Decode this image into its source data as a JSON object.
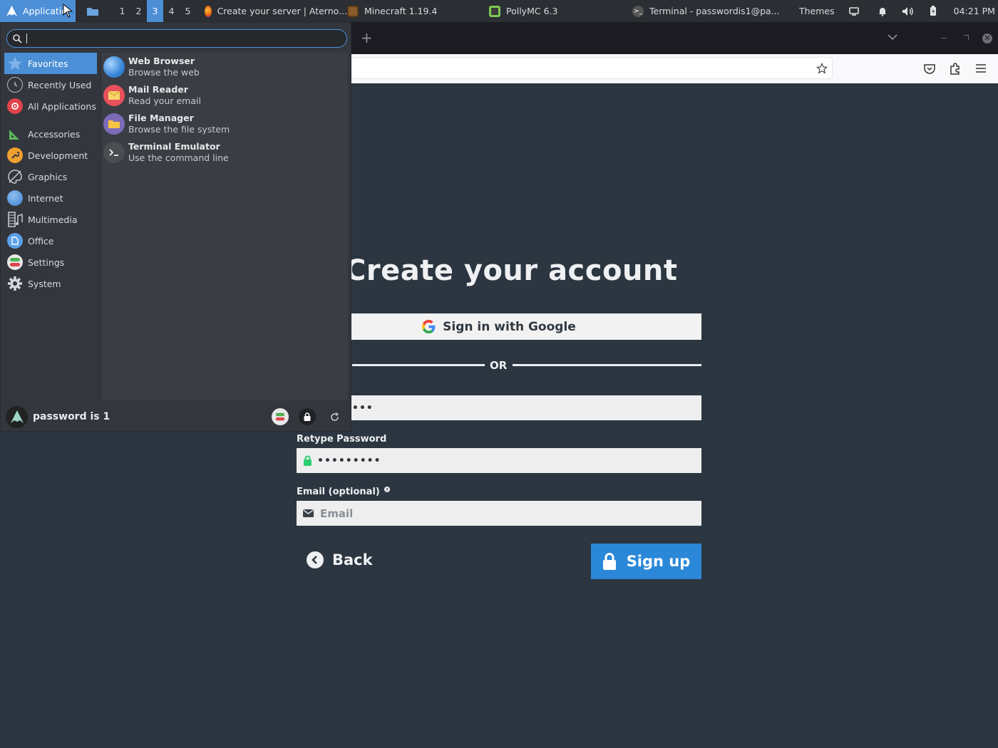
{
  "panel": {
    "applications_label": "Applications",
    "workspaces": [
      "1",
      "2",
      "3",
      "4",
      "5"
    ],
    "active_workspace": "3",
    "tasks": [
      {
        "icon": "firefox-icon",
        "title": "Create your server | Aterno..."
      },
      {
        "icon": "minecraft-icon",
        "title": "Minecraft 1.19.4"
      },
      {
        "icon": "pollymc-icon",
        "title": "PollyMC 6.3"
      },
      {
        "icon": "terminal-icon",
        "title": "Terminal - passwordis1@pa..."
      }
    ],
    "themes_label": "Themes",
    "clock": "04:21 PM"
  },
  "browser": {
    "new_tab_label": "+"
  },
  "menu": {
    "search_value": "",
    "categories_top": [
      {
        "name": "favorites",
        "label": "Favorites",
        "icon": "star-icon",
        "active": true
      },
      {
        "name": "recently-used",
        "label": "Recently Used",
        "icon": "clock-icon"
      },
      {
        "name": "all-applications",
        "label": "All Applications",
        "icon": "applications-icon"
      }
    ],
    "categories": [
      {
        "name": "accessories",
        "label": "Accessories",
        "icon": "accessories-icon"
      },
      {
        "name": "development",
        "label": "Development",
        "icon": "wrench-icon"
      },
      {
        "name": "graphics",
        "label": "Graphics",
        "icon": "palette-icon"
      },
      {
        "name": "internet",
        "label": "Internet",
        "icon": "globe-icon"
      },
      {
        "name": "multimedia",
        "label": "Multimedia",
        "icon": "film-icon"
      },
      {
        "name": "office",
        "label": "Office",
        "icon": "document-icon"
      },
      {
        "name": "settings",
        "label": "Settings",
        "icon": "toggle-icon"
      },
      {
        "name": "system",
        "label": "System",
        "icon": "gear-icon"
      }
    ],
    "apps": [
      {
        "name": "Web Browser",
        "desc": "Browse the web",
        "icon": "web-browser-icon"
      },
      {
        "name": "Mail Reader",
        "desc": "Read your email",
        "icon": "mail-icon"
      },
      {
        "name": "File Manager",
        "desc": "Browse the file system",
        "icon": "folder-icon"
      },
      {
        "name": "Terminal Emulator",
        "desc": "Use the command line",
        "icon": "terminal-icon"
      }
    ],
    "username": "password is 1"
  },
  "page": {
    "title": "Create your account",
    "google_button": "Sign in with Google",
    "or_label": "OR",
    "password_value": "•••",
    "retype_label": "Retype Password",
    "retype_value": "•••••••••",
    "email_label": "Email (optional)",
    "email_placeholder": "Email",
    "back_label": "Back",
    "signup_label": "Sign up"
  },
  "colors": {
    "accent": "#4c8fd6",
    "page_bg": "#2b3640",
    "signup_bg": "#2b88d8",
    "lock_green": "#2ecc71"
  }
}
